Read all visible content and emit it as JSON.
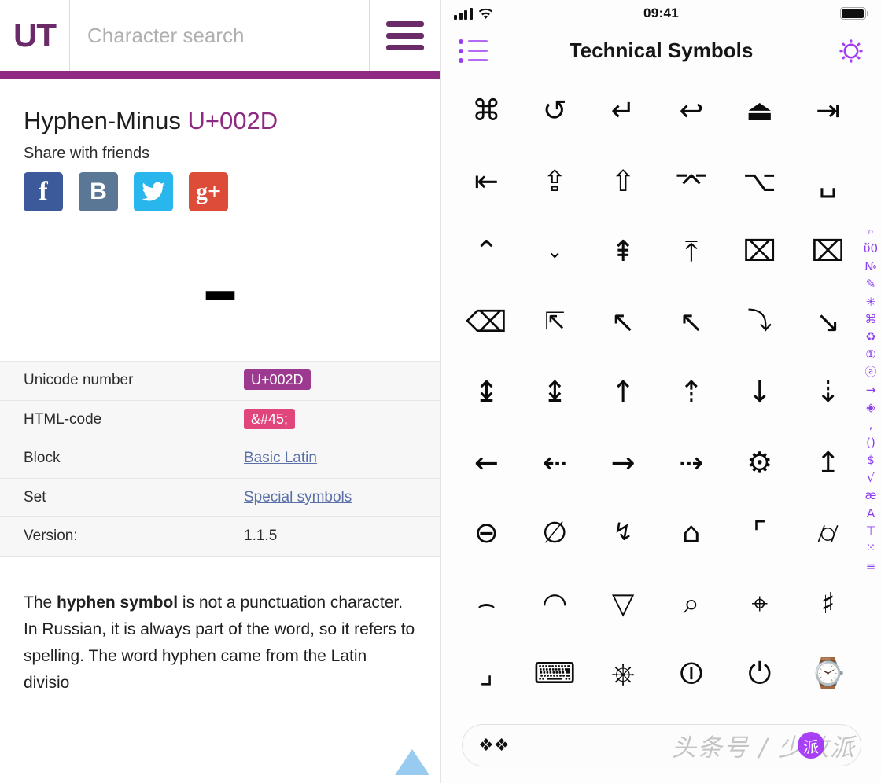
{
  "web": {
    "logo": "UT",
    "search": {
      "placeholder": "Character search",
      "value": ""
    },
    "menu_icon": "hamburger-icon",
    "character": {
      "name": "Hyphen-Minus",
      "codepoint": "U+002D",
      "glyph": "-"
    },
    "share": {
      "label": "Share with friends",
      "buttons": [
        {
          "name": "facebook",
          "label": "f",
          "color": "#3c5a99"
        },
        {
          "name": "vk",
          "label": "B",
          "color": "#5a7796"
        },
        {
          "name": "twitter",
          "label": "",
          "color": "#29b6ed"
        },
        {
          "name": "google-plus",
          "label": "g+",
          "color": "#dd4b39"
        }
      ]
    },
    "info_table": [
      {
        "key": "Unicode number",
        "value": "U+002D",
        "style": "badge-purple"
      },
      {
        "key": "HTML-code",
        "value": "&#45;",
        "style": "badge-pink"
      },
      {
        "key": "Block",
        "value": "Basic Latin",
        "style": "link"
      },
      {
        "key": "Set",
        "value": "Special symbols",
        "style": "link"
      },
      {
        "key": "Version:",
        "value": "1.1.5",
        "style": "plain"
      }
    ],
    "paragraph": {
      "lead": "The ",
      "bold": "hyphen symbol",
      "rest": " is not a punctuation character. In Russian, it is always part of the word, so it refers to spelling. The word hyphen came from the Latin divisio"
    },
    "scroll_top_icon": "scroll-to-top-icon"
  },
  "app": {
    "status": {
      "time": "09:41",
      "signal_icon": "signal-bars-icon",
      "wifi_icon": "wifi-icon",
      "battery_icon": "battery-full-icon"
    },
    "navbar": {
      "title": "Technical Symbols",
      "left_icon": "bulleted-list-icon",
      "right_icon": "gear-icon"
    },
    "symbols": [
      "⌘",
      "↺",
      "↵",
      "↩",
      "⏏",
      "⇥",
      "⇤",
      "⇪",
      "⇧",
      "⌤",
      "⌥",
      "␣",
      "⌃",
      "⌄",
      "⇞",
      "⤒",
      "⌧",
      "⌧",
      "⌫",
      "⇱",
      "↖",
      "↖",
      "⤵",
      "↘",
      "↨",
      "↨",
      "↑",
      "⇡",
      "↓",
      "⇣",
      "←",
      "⇠",
      "→",
      "⇢",
      "⚙",
      "↥",
      "⊖",
      "∅",
      "↯",
      "⌂",
      "⌜",
      "⌭",
      "⌢",
      "◠",
      "▽",
      "⌕",
      "⌖",
      "♯",
      "⌟",
      "⌨",
      "⎈",
      "⏼",
      "⏻",
      "⌚"
    ],
    "index": [
      "⌕",
      "ὕ0",
      "№",
      "✎",
      "✳",
      "⌘",
      "♻",
      "①",
      "ⓐ",
      "→",
      "◈",
      "‚",
      "()",
      "$",
      "√",
      "æ",
      "A",
      "⊤",
      "⁙",
      "≡"
    ],
    "bottom": {
      "icon": "diamond-cluster-icon",
      "watermark": "头条号 / 少数派",
      "watermark_badge": "派"
    }
  }
}
